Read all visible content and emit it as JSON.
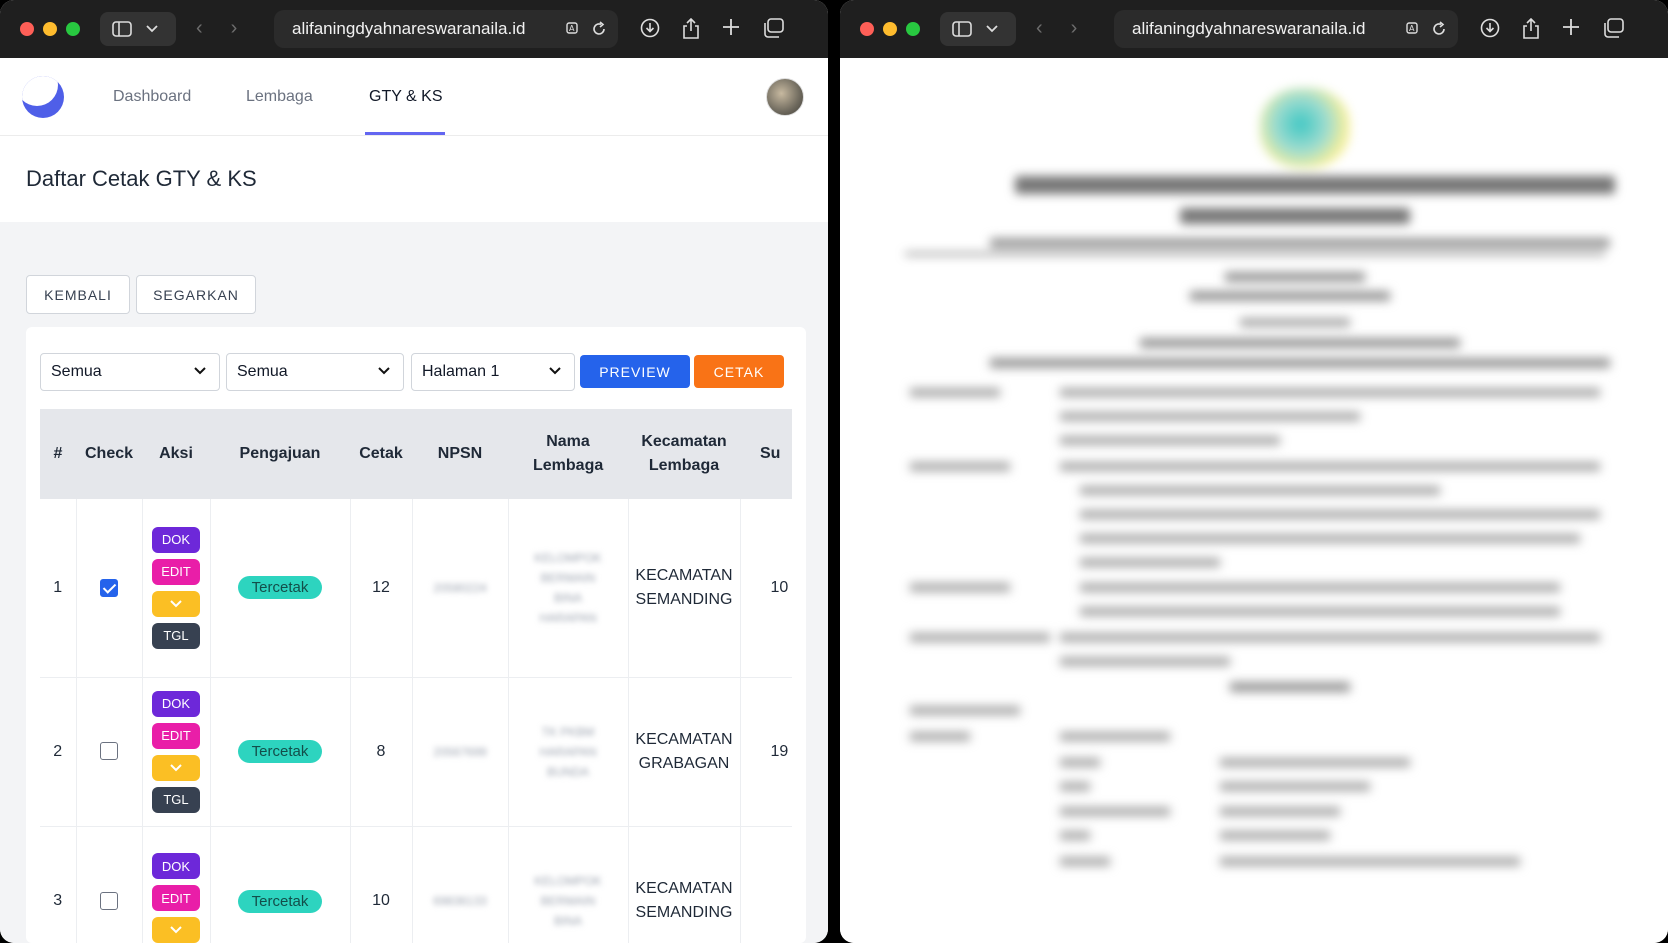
{
  "left_window": {
    "url": "alifaningdyahnareswaranaila.id",
    "nav": {
      "links": [
        "Dashboard",
        "Lembaga",
        "GTY & KS"
      ],
      "active": "GTY & KS"
    },
    "page_title": "Daftar Cetak GTY & KS",
    "buttons": {
      "back": "KEMBALI",
      "refresh": "SEGARKAN",
      "preview": "PREVIEW",
      "print": "CETAK"
    },
    "filters": {
      "filter1": "Semua",
      "filter2": "Semua",
      "page": "Halaman 1"
    },
    "table": {
      "headers": [
        "#",
        "Check",
        "Aksi",
        "Pengajuan",
        "Cetak",
        "NPSN",
        "Nama Lembaga",
        "Kecamatan Lembaga",
        "Su"
      ],
      "action_labels": {
        "dok": "DOK",
        "edit": "EDIT",
        "tgl": "TGL"
      },
      "rows": [
        {
          "no": "1",
          "checked": true,
          "status": "Tercetak",
          "cetak": "12",
          "npsn": "20580224",
          "nama": "KELOMPOK BERMAIN BINA HARAPAN",
          "kecamatan": "KECAMATAN SEMANDING",
          "su": "10"
        },
        {
          "no": "2",
          "checked": false,
          "status": "Tercetak",
          "cetak": "8",
          "npsn": "20567699",
          "nama": "TK PKBM HARAPAN BUNDA",
          "kecamatan": "KECAMATAN GRABAGAN",
          "su": "19"
        },
        {
          "no": "3",
          "checked": false,
          "status": "Tercetak",
          "cetak": "10",
          "npsn": "69836133",
          "nama": "KELOMPOK BERMAIN BINA",
          "kecamatan": "KECAMATAN SEMANDING",
          "su": ""
        }
      ]
    }
  },
  "right_window": {
    "url": "alifaningdyahnareswaranaila.id"
  },
  "colors": {
    "accent": "#6366f1",
    "preview_btn": "#2563eb",
    "print_btn": "#f97316",
    "dok": "#6d28d9",
    "edit": "#e91ea8",
    "dropdown": "#fbbf24",
    "tgl": "#374151",
    "badge": "#2dd4bf"
  }
}
